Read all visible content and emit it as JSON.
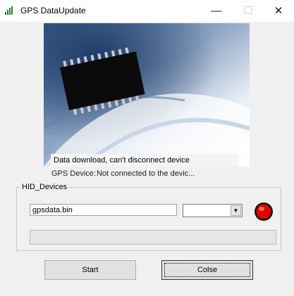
{
  "window": {
    "title": "GPS DataUpdate",
    "minimize_glyph": "—",
    "maximize_glyph": "☐",
    "close_glyph": "✕"
  },
  "status": {
    "message": "Data download, can't disconnect device",
    "device_label": "GPS Device:",
    "device_value": "Not connected to the devic..."
  },
  "hid_group": {
    "title": "HID_Devices",
    "filename_value": "gpsdata.bin",
    "device_select_value": "",
    "indicator_color": "#e00000",
    "progress_fraction": 0
  },
  "buttons": {
    "start": "Start",
    "close": "Colse"
  },
  "icons": {
    "app": "signal-bars-icon",
    "dropdown": "chevron-down-icon",
    "indicator": "status-led-icon"
  }
}
